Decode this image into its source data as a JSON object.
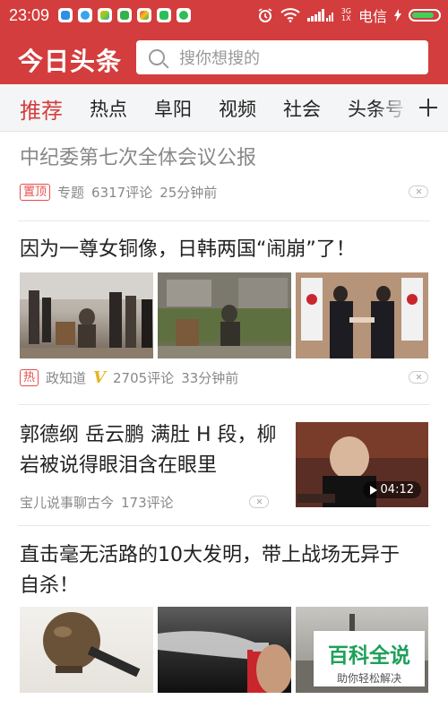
{
  "status_bar": {
    "time": "23:09",
    "network_top": "3G",
    "network_bottom": "1X",
    "carrier": "电信",
    "colors": {
      "bar": "#d43d3d",
      "battery_fill": "#3cd35a"
    },
    "notification_icons": [
      "app-icon-blue",
      "qq-icon",
      "app-icon-multicolor",
      "app-icon-green",
      "app-icon-multicolor",
      "app-icon-green-y",
      "app-icon-green-face"
    ]
  },
  "header": {
    "logo": "今日头条",
    "search_placeholder": "搜你想搜的"
  },
  "tabs": {
    "items": [
      "推荐",
      "热点",
      "阜阳",
      "视频",
      "社会",
      "头条号"
    ],
    "active": "推荐"
  },
  "articles": [
    {
      "title": "中纪委第七次全体会议公报",
      "tag": "置顶",
      "source": "专题",
      "comments": "6317评论",
      "time": "25分钟前"
    },
    {
      "title": "因为一尊女铜像，日韩两国“闹崩”了！",
      "tag": "热",
      "source": "政知道",
      "verified": "V",
      "comments": "2705评论",
      "time": "33分钟前"
    },
    {
      "title_line1": "郭德纲 岳云鹏 满肚 H 段，柳",
      "title_line2": "岩被说得眼泪含在眼里",
      "source": "宝儿说事聊古今",
      "comments": "173评论",
      "video_duration": "04:12"
    },
    {
      "title_line1": "直击毫无活路的10大发明，带上战场无异于",
      "title_line2": "自杀！"
    }
  ],
  "watermark": {
    "main": "百科全说",
    "sub": "助你轻松解决"
  }
}
